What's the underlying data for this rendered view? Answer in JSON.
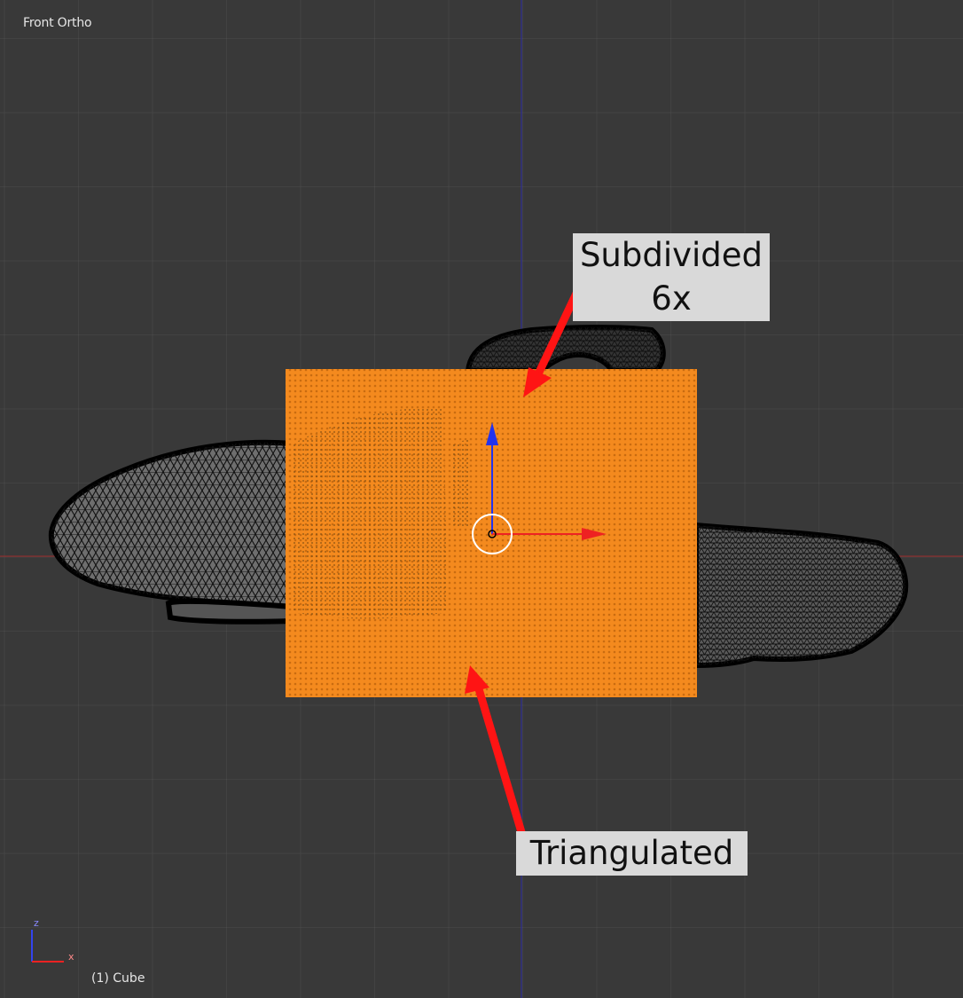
{
  "viewport": {
    "view_name": "Front Ortho",
    "active_object": "(1) Cube"
  },
  "axis_widget": {
    "z_label": "z",
    "x_label": "x"
  },
  "annotations": {
    "top": {
      "line1": "Subdivided",
      "line2": "6x"
    },
    "bottom": {
      "text": "Triangulated"
    }
  },
  "colors": {
    "background": "#393939",
    "grid": "#454545",
    "x_axis_line": "#a02a2a",
    "z_axis_line": "#2a2aa8",
    "selected_mesh": "#f48a1e",
    "mesh_fill": "#6e6e6e",
    "arrow_red": "#ff1414",
    "callout_bg": "#d9d9d9"
  },
  "icons": [
    "transform-gizmo-icon",
    "axis-orientation-icon",
    "annotation-arrow-icon"
  ]
}
